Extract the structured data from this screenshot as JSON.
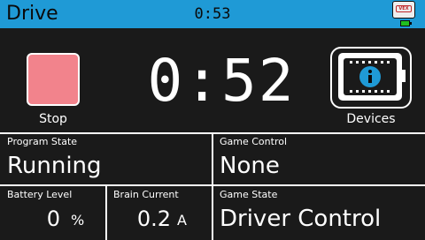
{
  "header": {
    "title": "Drive",
    "timer": "0:53",
    "logo_text": "VEX",
    "battery_color": "#20c020",
    "background_color": "#1f9ad6"
  },
  "controls": {
    "stop_label": "Stop",
    "stop_color": "#f2838c",
    "big_timer": "0:52",
    "devices_label": "Devices",
    "devices_icon": "info-icon"
  },
  "status": {
    "program_state": {
      "label": "Program State",
      "value": "Running"
    },
    "game_control": {
      "label": "Game Control",
      "value": "None"
    },
    "battery_level": {
      "label": "Battery Level",
      "value": "0",
      "unit": "%"
    },
    "brain_current": {
      "label": "Brain Current",
      "value": "0.2",
      "unit": "A"
    },
    "game_state": {
      "label": "Game State",
      "value": "Driver Control"
    }
  }
}
